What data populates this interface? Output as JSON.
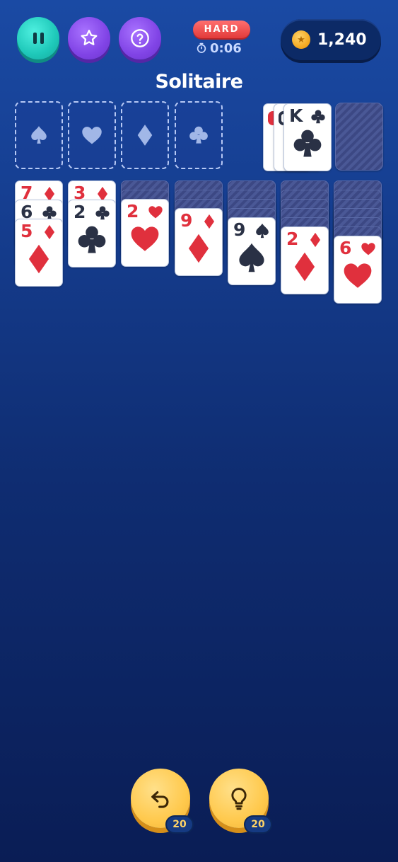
{
  "header": {
    "difficulty": "HARD",
    "timer": "0:06",
    "coins": "1,240",
    "title": "Solitaire"
  },
  "buttons": {
    "pause": "pause-icon",
    "favorite": "star-icon",
    "help": "help-icon",
    "undo": "undo-icon",
    "hint": "lightbulb-icon"
  },
  "counts": {
    "undo": "20",
    "hint": "20"
  },
  "foundations": [
    "spade",
    "heart",
    "diamond",
    "club"
  ],
  "waste": {
    "top_card": {
      "rank": "K",
      "suit": "club"
    },
    "hidden_peeks": 2
  },
  "tableau": [
    {
      "face_down": 0,
      "face_up": [
        {
          "rank": "7",
          "suit": "diamond"
        },
        {
          "rank": "6",
          "suit": "club"
        },
        {
          "rank": "5",
          "suit": "diamond"
        }
      ]
    },
    {
      "face_down": 0,
      "face_up": [
        {
          "rank": "3",
          "suit": "diamond"
        },
        {
          "rank": "2",
          "suit": "club"
        }
      ]
    },
    {
      "face_down": 2,
      "face_up": [
        {
          "rank": "2",
          "suit": "heart"
        }
      ]
    },
    {
      "face_down": 3,
      "face_up": [
        {
          "rank": "9",
          "suit": "diamond"
        }
      ]
    },
    {
      "face_down": 4,
      "face_up": [
        {
          "rank": "9",
          "suit": "spade"
        }
      ]
    },
    {
      "face_down": 5,
      "face_up": [
        {
          "rank": "2",
          "suit": "diamond"
        }
      ]
    },
    {
      "face_down": 6,
      "face_up": [
        {
          "rank": "6",
          "suit": "heart"
        }
      ]
    }
  ],
  "colors": {
    "red_suit": "#e0303d",
    "black_suit": "#2a3145",
    "accent_teal": "#1ec8b9",
    "accent_purple": "#8144e6",
    "gold": "#ffc94d"
  }
}
